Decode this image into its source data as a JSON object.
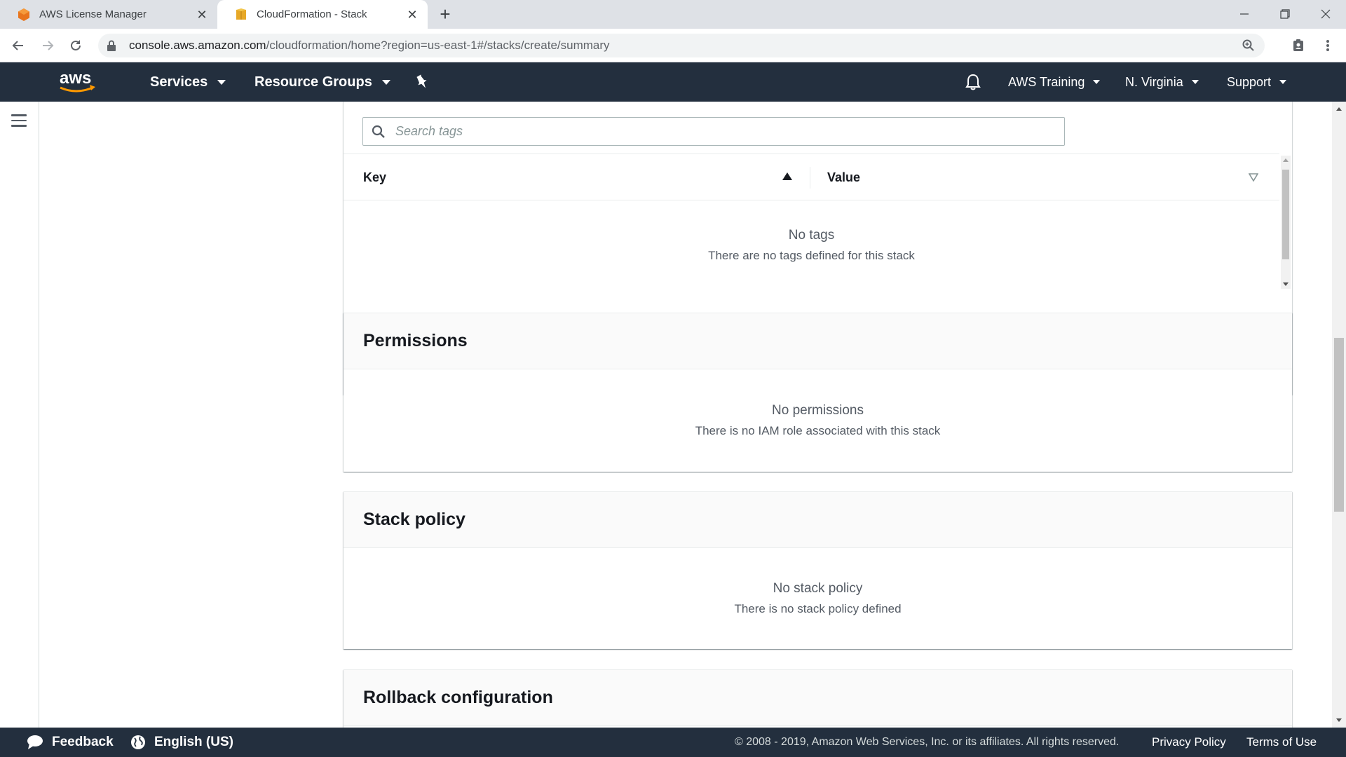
{
  "browser": {
    "tabs": [
      {
        "title": "AWS License Manager",
        "active": false
      },
      {
        "title": "CloudFormation - Stack",
        "active": true
      }
    ],
    "url_host": "console.aws.amazon.com",
    "url_path": "/cloudformation/home?region=us-east-1#/stacks/create/summary"
  },
  "header": {
    "services_label": "Services",
    "resource_groups_label": "Resource Groups",
    "account_label": "AWS Training",
    "region_label": "N. Virginia",
    "support_label": "Support"
  },
  "tags": {
    "search_placeholder": "Search tags",
    "columns": [
      "Key",
      "Value"
    ],
    "empty_title": "No tags",
    "empty_subtitle": "There are no tags defined for this stack"
  },
  "permissions": {
    "title": "Permissions",
    "empty_title": "No permissions",
    "empty_subtitle": "There is no IAM role associated with this stack"
  },
  "stack_policy": {
    "title": "Stack policy",
    "empty_title": "No stack policy",
    "empty_subtitle": "There is no stack policy defined"
  },
  "rollback": {
    "title": "Rollback configuration"
  },
  "footer": {
    "feedback_label": "Feedback",
    "language_label": "English (US)",
    "copyright": "© 2008 - 2019, Amazon Web Services, Inc. or its affiliates. All rights reserved.",
    "privacy_label": "Privacy Policy",
    "terms_label": "Terms of Use"
  },
  "colors": {
    "aws_nav_bg": "#232f3e",
    "aws_orange": "#ff9900",
    "panel_header_bg": "#fafafa"
  }
}
